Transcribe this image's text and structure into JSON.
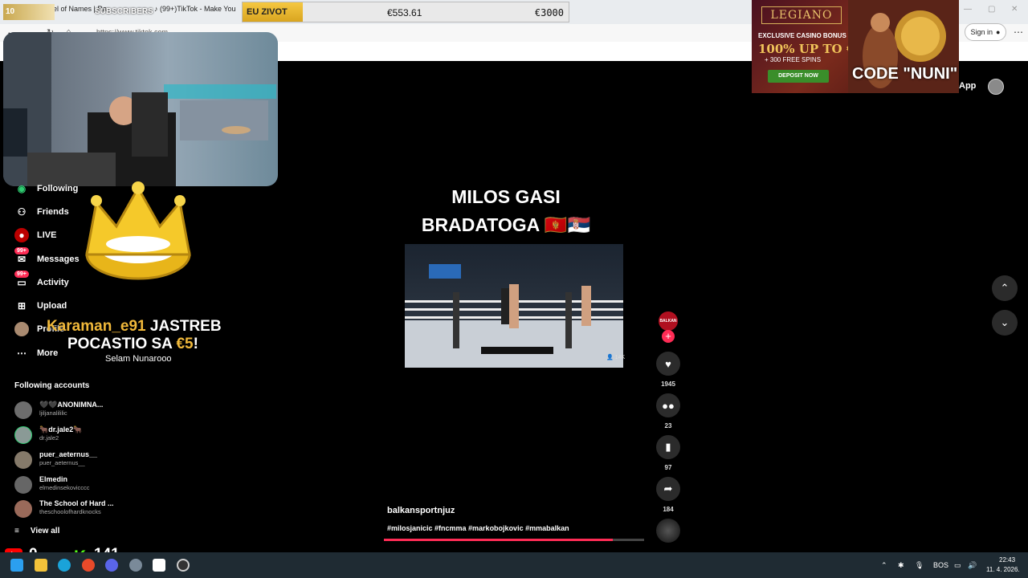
{
  "browser": {
    "tab1": "el of Names | Ra",
    "tab2": "(99+)TikTok - Make You",
    "url": "https://www.tiktok.com",
    "signin": "Sign in",
    "app": "App"
  },
  "stream": {
    "sub_count": "10",
    "sub_label": "SUBSCRIBERS",
    "ticker_label": "EU ZIVOT",
    "ticker_current": "€553.61",
    "ticker_goal": "€3000",
    "code": "CODE \"NUNI\"",
    "youtube_count": "0",
    "kick_count": "141",
    "donor_name": "Karaman_e91",
    "donor_text1": " JASTREB",
    "donor_text2": "POCASTIO SA ",
    "donor_amount": "€5",
    "donor_excl": "!",
    "donor_message": "Selam Nunarooo"
  },
  "ad": {
    "brand": "LEGIANO",
    "line1": "EXCLUSIVE CASINO BONUS",
    "line2": "100% UP TO €500",
    "line3": "+ 300 FREE SPINS",
    "cta": "DEPOSIT NOW"
  },
  "sidebar": {
    "items": [
      {
        "label": "Following",
        "icon": "following-icon"
      },
      {
        "label": "Friends",
        "icon": "friends-icon"
      },
      {
        "label": "LIVE",
        "icon": "live-icon"
      },
      {
        "label": "Messages",
        "icon": "messages-icon",
        "badge": "99+"
      },
      {
        "label": "Activity",
        "icon": "activity-icon",
        "badge": "99+"
      },
      {
        "label": "Upload",
        "icon": "upload-icon"
      },
      {
        "label": "Profile",
        "icon": "profile-icon"
      },
      {
        "label": "More",
        "icon": "more-icon"
      }
    ],
    "following_title": "Following accounts",
    "accounts": [
      {
        "name": "🖤🖤ANONIMNA...",
        "user": "ljiljanalililic"
      },
      {
        "name": "🐂dr.jale2🐂",
        "user": "dr.jale2"
      },
      {
        "name": "puer_aeternus__",
        "user": "puer_aeternus__"
      },
      {
        "name": "Elmedin",
        "user": "elmedinsekovicccc"
      },
      {
        "name": "The School of Hard ...",
        "user": "theschoolofhardknocks"
      }
    ],
    "view_all": "View all"
  },
  "video": {
    "title1": "MILOS GASI",
    "title2": "BRADATOGA 🇲🇪🇷🇸",
    "viewers": "14K",
    "author": "balkansportnjuz",
    "hashtags": "#milosjanicic #fncmma #markobojkovic #mmabalkan",
    "progress": 0.88,
    "creator_badge": "BALKAN",
    "likes": "1945",
    "comments": "23",
    "saves": "97",
    "shares": "184"
  },
  "taskbar": {
    "lang": "BOS",
    "time": "22:43",
    "date": "11. 4. 2026."
  }
}
